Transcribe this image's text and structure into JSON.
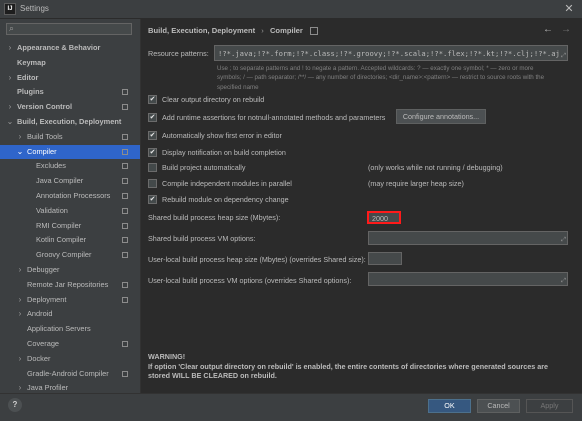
{
  "window": {
    "title": "Settings",
    "app_icon_text": "IJ"
  },
  "sidebar": {
    "items": [
      {
        "label": "Appearance & Behavior",
        "level": 0,
        "arrow": "›",
        "pin": false,
        "bold": true
      },
      {
        "label": "Keymap",
        "level": 0,
        "arrow": "",
        "pin": false,
        "bold": true
      },
      {
        "label": "Editor",
        "level": 0,
        "arrow": "›",
        "pin": false,
        "bold": true
      },
      {
        "label": "Plugins",
        "level": 0,
        "arrow": "",
        "pin": true,
        "bold": true
      },
      {
        "label": "Version Control",
        "level": 0,
        "arrow": "›",
        "pin": true,
        "bold": true
      },
      {
        "label": "Build, Execution, Deployment",
        "level": 0,
        "arrow": "⌄",
        "pin": false,
        "bold": true
      },
      {
        "label": "Build Tools",
        "level": 1,
        "arrow": "›",
        "pin": true,
        "bold": false
      },
      {
        "label": "Compiler",
        "level": 1,
        "arrow": "⌄",
        "pin": true,
        "bold": false,
        "selected": true
      },
      {
        "label": "Excludes",
        "level": 2,
        "arrow": "",
        "pin": true,
        "bold": false
      },
      {
        "label": "Java Compiler",
        "level": 2,
        "arrow": "",
        "pin": true,
        "bold": false
      },
      {
        "label": "Annotation Processors",
        "level": 2,
        "arrow": "",
        "pin": true,
        "bold": false
      },
      {
        "label": "Validation",
        "level": 2,
        "arrow": "",
        "pin": true,
        "bold": false
      },
      {
        "label": "RMI Compiler",
        "level": 2,
        "arrow": "",
        "pin": true,
        "bold": false
      },
      {
        "label": "Kotlin Compiler",
        "level": 2,
        "arrow": "",
        "pin": true,
        "bold": false
      },
      {
        "label": "Groovy Compiler",
        "level": 2,
        "arrow": "",
        "pin": true,
        "bold": false
      },
      {
        "label": "Debugger",
        "level": 1,
        "arrow": "›",
        "pin": false,
        "bold": false
      },
      {
        "label": "Remote Jar Repositories",
        "level": 1,
        "arrow": "",
        "pin": true,
        "bold": false
      },
      {
        "label": "Deployment",
        "level": 1,
        "arrow": "›",
        "pin": true,
        "bold": false
      },
      {
        "label": "Android",
        "level": 1,
        "arrow": "›",
        "pin": false,
        "bold": false
      },
      {
        "label": "Application Servers",
        "level": 1,
        "arrow": "",
        "pin": false,
        "bold": false
      },
      {
        "label": "Coverage",
        "level": 1,
        "arrow": "",
        "pin": true,
        "bold": false
      },
      {
        "label": "Docker",
        "level": 1,
        "arrow": "›",
        "pin": false,
        "bold": false
      },
      {
        "label": "Gradle-Android Compiler",
        "level": 1,
        "arrow": "",
        "pin": true,
        "bold": false
      },
      {
        "label": "Java Profiler",
        "level": 1,
        "arrow": "›",
        "pin": false,
        "bold": false
      }
    ]
  },
  "breadcrumb": {
    "parent": "Build, Execution, Deployment",
    "separator": "›",
    "current": "Compiler"
  },
  "nav": {
    "back": "←",
    "forward": "→"
  },
  "resource": {
    "label": "Resource patterns:",
    "value": "!?*.java;!?*.form;!?*.class;!?*.groovy;!?*.scala;!?*.flex;!?*.kt;!?*.clj;!?*.aj",
    "hint": "Use ; to separate patterns and ! to negate a pattern. Accepted wildcards: ? — exactly one symbol; * — zero or more symbols; / — path separator; /**/ — any number of directories; <dir_name>:<pattern> — restrict to source roots with the specified name"
  },
  "options": {
    "clear_output": {
      "label": "Clear output directory on rebuild",
      "checked": "✔"
    },
    "runtime_assertions": {
      "label": "Add runtime assertions for notnull-annotated methods and parameters",
      "checked": "✔"
    },
    "configure_annotations": "Configure annotations...",
    "show_first_error": {
      "label": "Automatically show first error in editor",
      "checked": "✔"
    },
    "build_notification": {
      "label": "Display notification on build completion",
      "checked": "✔"
    },
    "build_auto": {
      "label": "Build project automatically",
      "checked": "",
      "note": "(only works while not running / debugging)"
    },
    "parallel": {
      "label": "Compile independent modules in parallel",
      "checked": "",
      "note": "(may require larger heap size)"
    },
    "rebuild_dep": {
      "label": "Rebuild module on dependency change",
      "checked": "✔"
    }
  },
  "heap": {
    "label": "Shared build process heap size (Mbytes):",
    "value": "2000"
  },
  "shared_vm": {
    "label": "Shared build process VM options:",
    "value": ""
  },
  "user_heap": {
    "label": "User-local build process heap size (Mbytes) (overrides Shared size):",
    "value": ""
  },
  "user_vm": {
    "label": "User-local build process VM options (overrides Shared options):",
    "value": ""
  },
  "warning": {
    "title": "WARNING!",
    "text": "If option 'Clear output directory on rebuild' is enabled, the entire contents of directories where generated sources are stored WILL BE CLEARED on rebuild."
  },
  "buttons": {
    "ok": "OK",
    "cancel": "Cancel",
    "apply": "Apply",
    "help": "?"
  },
  "colors": {
    "accent": "#2f65ca",
    "highlight_border": "#ff1a1a",
    "primary_button": "#365880"
  }
}
